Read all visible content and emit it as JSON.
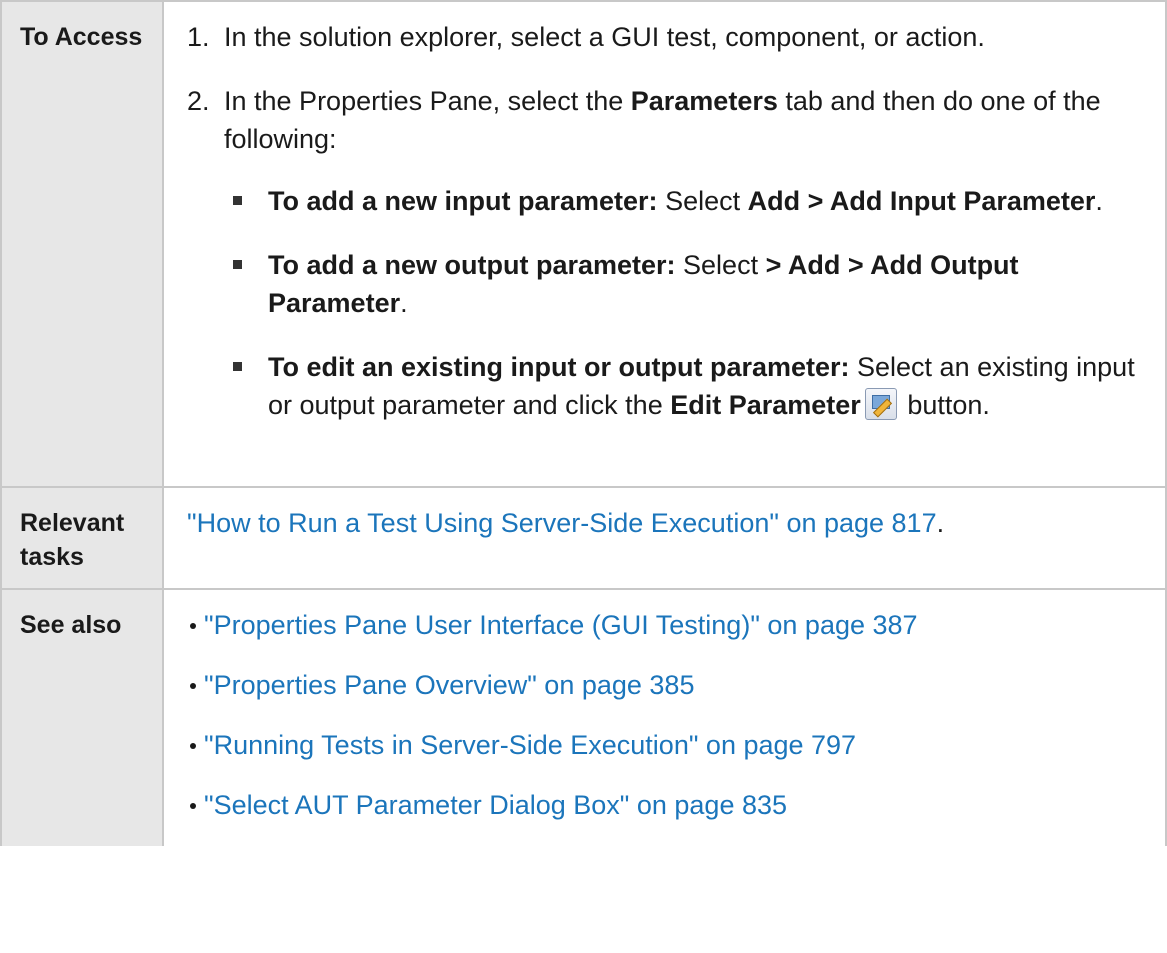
{
  "rows": [
    {
      "header": "To Access",
      "steps": [
        {
          "num": "1.",
          "text": "In the solution explorer, select a GUI test, component, or action."
        },
        {
          "num": "2.",
          "pre": "In the Properties Pane, select the ",
          "bold": "Parameters",
          "post": " tab and then do one of the following:",
          "options": [
            {
              "bold": "To add a new input parameter:",
              "mid": " Select ",
              "bold2": "Add > Add Input Parameter",
              "end": "."
            },
            {
              "bold": "To add a new output parameter:",
              "mid": " Select ",
              "bold2": "> Add > Add Output Parameter",
              "end": "."
            },
            {
              "bold": "To edit an existing input or output parameter:",
              "mid": " Select an existing input or output parameter and click the ",
              "bold2": "Edit Parameter",
              "end": " button."
            }
          ]
        }
      ]
    },
    {
      "header": "Relevant tasks",
      "link": "\"How to Run a Test Using Server-Side Execution\" on page 817",
      "end": "."
    },
    {
      "header": "See also",
      "links": [
        "\"Properties Pane User Interface (GUI Testing)\" on page 387",
        "\"Properties Pane Overview\" on page 385",
        "\"Running Tests in Server-Side Execution\" on page 797",
        "\"Select AUT Parameter Dialog Box\" on page 835"
      ]
    }
  ],
  "icons": {
    "edit_parameter": "edit-parameter-icon"
  }
}
